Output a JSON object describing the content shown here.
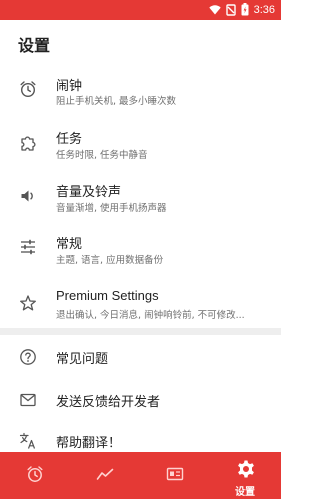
{
  "status": {
    "time": "3:36"
  },
  "page_title": "设置",
  "settings": [
    {
      "title": "闹钟",
      "subtitle": "阻止手机关机, 最多小睡次数",
      "icon": "alarm-clock-icon"
    },
    {
      "title": "任务",
      "subtitle": "任务时限, 任务中静音",
      "icon": "puzzle-icon"
    },
    {
      "title": "音量及铃声",
      "subtitle": "音量渐增, 使用手机扬声器",
      "icon": "speaker-icon"
    },
    {
      "title": "常规",
      "subtitle": "主题, 语言, 应用数据备份",
      "icon": "sliders-icon"
    },
    {
      "title": "Premium Settings",
      "subtitle": "退出确认, 今日消息, 闹钟响铃前, 不可修改...",
      "icon": "star-icon"
    }
  ],
  "support": [
    {
      "title": "常见问题",
      "icon": "help-circle-icon"
    },
    {
      "title": "发送反馈给开发者",
      "icon": "mail-icon"
    },
    {
      "title": "帮助翻译！",
      "icon": "translate-icon"
    }
  ],
  "bottom_nav": [
    {
      "name": "alarm",
      "icon": "alarm-clock-icon",
      "label": ""
    },
    {
      "name": "report",
      "icon": "trend-line-icon",
      "label": ""
    },
    {
      "name": "news",
      "icon": "news-card-icon",
      "label": ""
    },
    {
      "name": "settings",
      "icon": "gear-icon",
      "label": "设置",
      "active": true
    }
  ],
  "colors": {
    "accent": "#e53935",
    "divider": "#eeeeee",
    "subtitle": "#6f6f6f"
  }
}
